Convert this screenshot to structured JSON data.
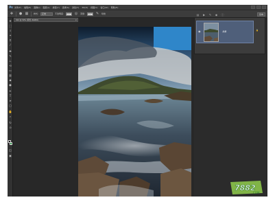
{
  "app": {
    "logo": "Ps"
  },
  "menubar": {
    "items": [
      "文件(F)",
      "编辑(E)",
      "图像(I)",
      "图层(L)",
      "类型(Y)",
      "选择(S)",
      "滤镜(T)",
      "3D(D)",
      "视图(V)",
      "窗口(W)",
      "帮助(H)"
    ]
  },
  "options": {
    "style_label": "样式:",
    "style_value": "正常",
    "opacity_label": "不透明度:",
    "opacity_value": "100%",
    "flow_label": "流量:",
    "flow_value": "100%",
    "airbrush_label": "喷枪",
    "workspace": "基本"
  },
  "document": {
    "tab_title": "012 @ 50% (背景, RGB/8)",
    "close_glyph": "×"
  },
  "layers": {
    "items": [
      {
        "name": "背景",
        "visible": true,
        "locked": true
      }
    ]
  },
  "watermark": {
    "text": "7882",
    "suffix": "COM"
  },
  "colors": {
    "foreground": "#111111",
    "background": "#1f8d3a",
    "selection": "#4f5f7a",
    "panel": "#3c3c3c"
  },
  "icons": [
    "move-icon",
    "marquee-icon",
    "lasso-icon",
    "crop-icon",
    "brush-icon",
    "eye-icon",
    "lock-icon"
  ]
}
